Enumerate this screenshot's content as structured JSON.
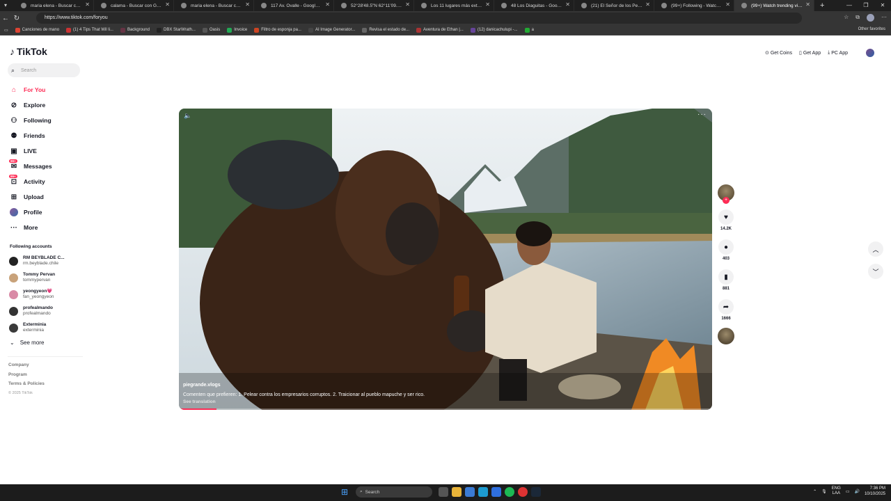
{
  "browser": {
    "tabs": [
      {
        "label": "maria elena - Buscar con Google",
        "active": false
      },
      {
        "label": "calama - Buscar con Google",
        "active": false
      },
      {
        "label": "maria elena - Buscar con Google",
        "active": false
      },
      {
        "label": "117 Av. Ovalle - Google Maps",
        "active": false
      },
      {
        "label": "52°28'48.5\"N 62°11'09.0\"E - Go",
        "active": false
      },
      {
        "label": "Los 11 lugares más extraños qu",
        "active": false
      },
      {
        "label": "48 Los Diaguitas - Google Maps",
        "active": false
      },
      {
        "label": "(21) El Señor de los Perros en X",
        "active": false
      },
      {
        "label": "(99+) Following - Watch vid",
        "active": false
      },
      {
        "label": "(99+) Watch trending vide",
        "active": true
      }
    ],
    "url": "https://www.tiktok.com/foryou",
    "bookmarks": [
      "Canciones de mano",
      "(1) 4 Tips That Wil li...",
      "Background",
      "DBX StarWrath...",
      "Oasis",
      "Invoice",
      "Filtro de esponja pa...",
      "AI Image Generator...",
      "Revisa el estado de...",
      "Aventura de Ethan |...",
      "(12) danicachulupi -...",
      "a"
    ],
    "other_favorites": "Other favorites"
  },
  "tiktok": {
    "logo": "TikTok",
    "search_placeholder": "Search",
    "nav": [
      {
        "label": "For You",
        "icon": "home-icon",
        "active": true
      },
      {
        "label": "Explore",
        "icon": "compass-icon",
        "active": false
      },
      {
        "label": "Following",
        "icon": "following-icon",
        "active": false
      },
      {
        "label": "Friends",
        "icon": "friends-icon",
        "active": false
      },
      {
        "label": "LIVE",
        "icon": "live-icon",
        "active": false
      },
      {
        "label": "Messages",
        "icon": "messages-icon",
        "active": false,
        "badge": "99+"
      },
      {
        "label": "Activity",
        "icon": "activity-icon",
        "active": false,
        "badge": "99+"
      },
      {
        "label": "Upload",
        "icon": "upload-icon",
        "active": false
      },
      {
        "label": "Profile",
        "icon": "profile-avatar",
        "active": false
      },
      {
        "label": "More",
        "icon": "more-icon",
        "active": false
      }
    ],
    "following_title": "Following accounts",
    "following": [
      {
        "name": "RM BEYBLADE C...",
        "handle": "rm.beyblade.chile",
        "color": "#222222"
      },
      {
        "name": "Tommy Pervan",
        "handle": "tommypervan",
        "color": "#c8a27a"
      },
      {
        "name": "yeongyeon💗",
        "handle": "fan_yeongyeon",
        "color": "#d98aa6"
      },
      {
        "name": "profealmando",
        "handle": "profealmando",
        "color": "#333333"
      },
      {
        "name": "Exterminia",
        "handle": "exterminia",
        "color": "#3a3a3a"
      }
    ],
    "see_more": "See more",
    "footer": {
      "company": "Company",
      "program": "Program",
      "terms": "Terms & Policies",
      "copyright": "© 2025 TikTok"
    },
    "top_right": {
      "get_coins": "Get Coins",
      "get_app": "Get App",
      "pc_app": "PC App"
    },
    "video": {
      "author": "piegrande.vlogs",
      "caption": "Comenten que prefieren:  1.  Pelear contra los empresarios corruptos.  2.  Traicionar al pueblo mapuche y ser rico.",
      "see_translation": "See translation",
      "progress": 0.07
    },
    "actions": {
      "likes": "14.2K",
      "comments": "403",
      "saves": "881",
      "shares": "1666"
    },
    "accent_color": "#fe2c55"
  },
  "taskbar": {
    "search_placeholder": "Search",
    "lang_top": "ENG",
    "lang_bottom": "LAA",
    "time": "7:36 PM",
    "date": "10/10/2025"
  }
}
